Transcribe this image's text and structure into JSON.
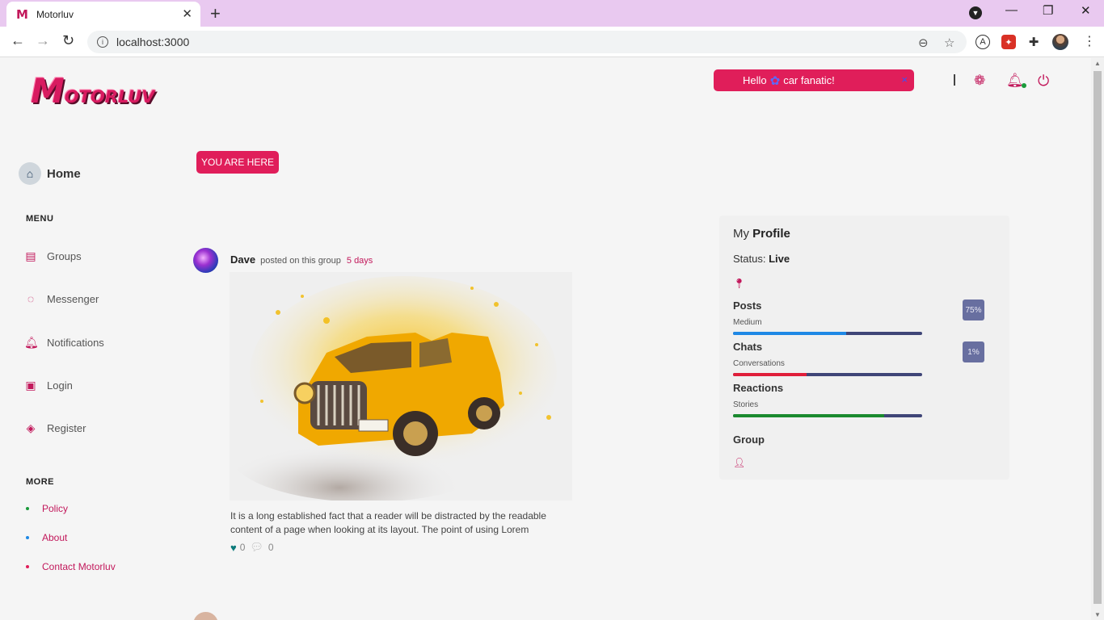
{
  "browser": {
    "tab_title": "Motorluv",
    "tab_favicon": "M",
    "url": "localhost:3000"
  },
  "header": {
    "logo_first": "M",
    "logo_rest": "OTORLUV",
    "hello_prefix": "Hello",
    "hello_suffix": "car fanatic!",
    "hello_close": "×"
  },
  "breadcrumb": {
    "label": "YOU ARE HERE"
  },
  "sidebar": {
    "home_label": "Home",
    "menu_title": "MENU",
    "menu_items": [
      {
        "label": "Groups",
        "icon": "document-icon"
      },
      {
        "label": "Messenger",
        "icon": "chat-bubble-icon"
      },
      {
        "label": "Notifications",
        "icon": "bell-icon"
      },
      {
        "label": "Login",
        "icon": "window-icon"
      },
      {
        "label": "Register",
        "icon": "layers-icon"
      }
    ],
    "more_title": "MORE",
    "more_items": [
      {
        "label": "Policy",
        "dot_color": "#1a9a3a"
      },
      {
        "label": "About",
        "dot_color": "#1e88e5"
      },
      {
        "label": "Contact Motorluv",
        "dot_color": "#e01e5a"
      }
    ]
  },
  "post": {
    "author": "Dave",
    "action": "posted on this group",
    "time": "5 days",
    "text": "It is a long established fact that a reader will be distracted by the readable content of a page when looking at its layout. The point of using Lorem",
    "likes": "0",
    "comments": "0"
  },
  "profile": {
    "title_prefix": "My",
    "title_bold": "Profile",
    "status_label": "Status:",
    "status_value": "Live",
    "stats": [
      {
        "name": "Posts",
        "sub": "Medium",
        "fill": 0.6,
        "color": "#1e88e5",
        "badge": "75%"
      },
      {
        "name": "Chats",
        "sub": "Conversations",
        "fill": 0.39,
        "color": "#e01e3a",
        "badge": "1%"
      },
      {
        "name": "Reactions",
        "sub": "Stories",
        "fill": 0.8,
        "color": "#1a8a2e",
        "badge": ""
      }
    ],
    "group_label": "Group"
  },
  "colors": {
    "accent": "#e01e5a",
    "brand": "#c2185b",
    "tab_bar": "#e9c9f0"
  }
}
